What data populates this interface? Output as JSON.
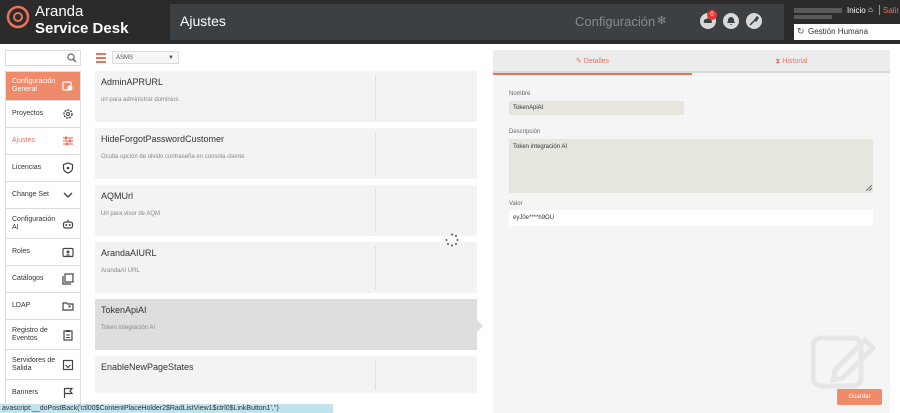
{
  "brand": {
    "line1": "Aranda",
    "line2": "Service Desk"
  },
  "header": {
    "page_title": "Ajustes",
    "config_label": "Configuración",
    "notification_count": "0",
    "inicio_label": "Inicio",
    "salir_label": "Salir",
    "group_label": "Gestión Humana"
  },
  "sidebar": {
    "items": [
      {
        "label": "Configuración General",
        "icon": "settings-icon"
      },
      {
        "label": "Proyectos",
        "icon": "gear-icon"
      },
      {
        "label": "Ajustes",
        "icon": "sliders-icon"
      },
      {
        "label": "Licencias",
        "icon": "shield-icon"
      },
      {
        "label": "Change Set",
        "icon": "chevron-down-icon"
      },
      {
        "label": "Configuración AI",
        "icon": "robot-icon"
      },
      {
        "label": "Roles",
        "icon": "id-card-icon"
      },
      {
        "label": "Catálogos",
        "icon": "library-icon"
      },
      {
        "label": "LDAP",
        "icon": "folder-user-icon"
      },
      {
        "label": "Registro de Eventos",
        "icon": "clipboard-icon"
      },
      {
        "label": "Servidores de Salida",
        "icon": "outbox-icon"
      },
      {
        "label": "Banners",
        "icon": "flag-icon"
      }
    ]
  },
  "list": {
    "filter_value": "ASMS",
    "items": [
      {
        "title": "AdminAPRURL",
        "description": "url para administrar dominios"
      },
      {
        "title": "HideForgotPasswordCustomer",
        "description": "Oculta opción de olvido contraseña en consola cliente"
      },
      {
        "title": "AQMUrl",
        "description": "Url para visor de AQM"
      },
      {
        "title": "ArandaAIURL",
        "description": "ArandaAI URL"
      },
      {
        "title": "TokenApiAI",
        "description": "Token integración AI"
      },
      {
        "title": "EnableNewPageStates",
        "description": ""
      }
    ]
  },
  "details": {
    "tab_details": "Detalles",
    "tab_history": "Historial",
    "name_label": "Nombre",
    "name_value": "TokenApiAI",
    "description_label": "Descripción",
    "description_value": "Token integración AI",
    "value_label": "Valor",
    "value_value": "eyJ0e****h9OU",
    "save_label": "Guardar"
  },
  "status_bar": "avascript:__doPostBack('ctl00$ContentPlaceHolder2$RadListView1$ctrl0$LinkButton1','')",
  "colors": {
    "accent": "#ef8a6a",
    "topbar": "#2b2b2b",
    "panel": "#3c4043"
  }
}
